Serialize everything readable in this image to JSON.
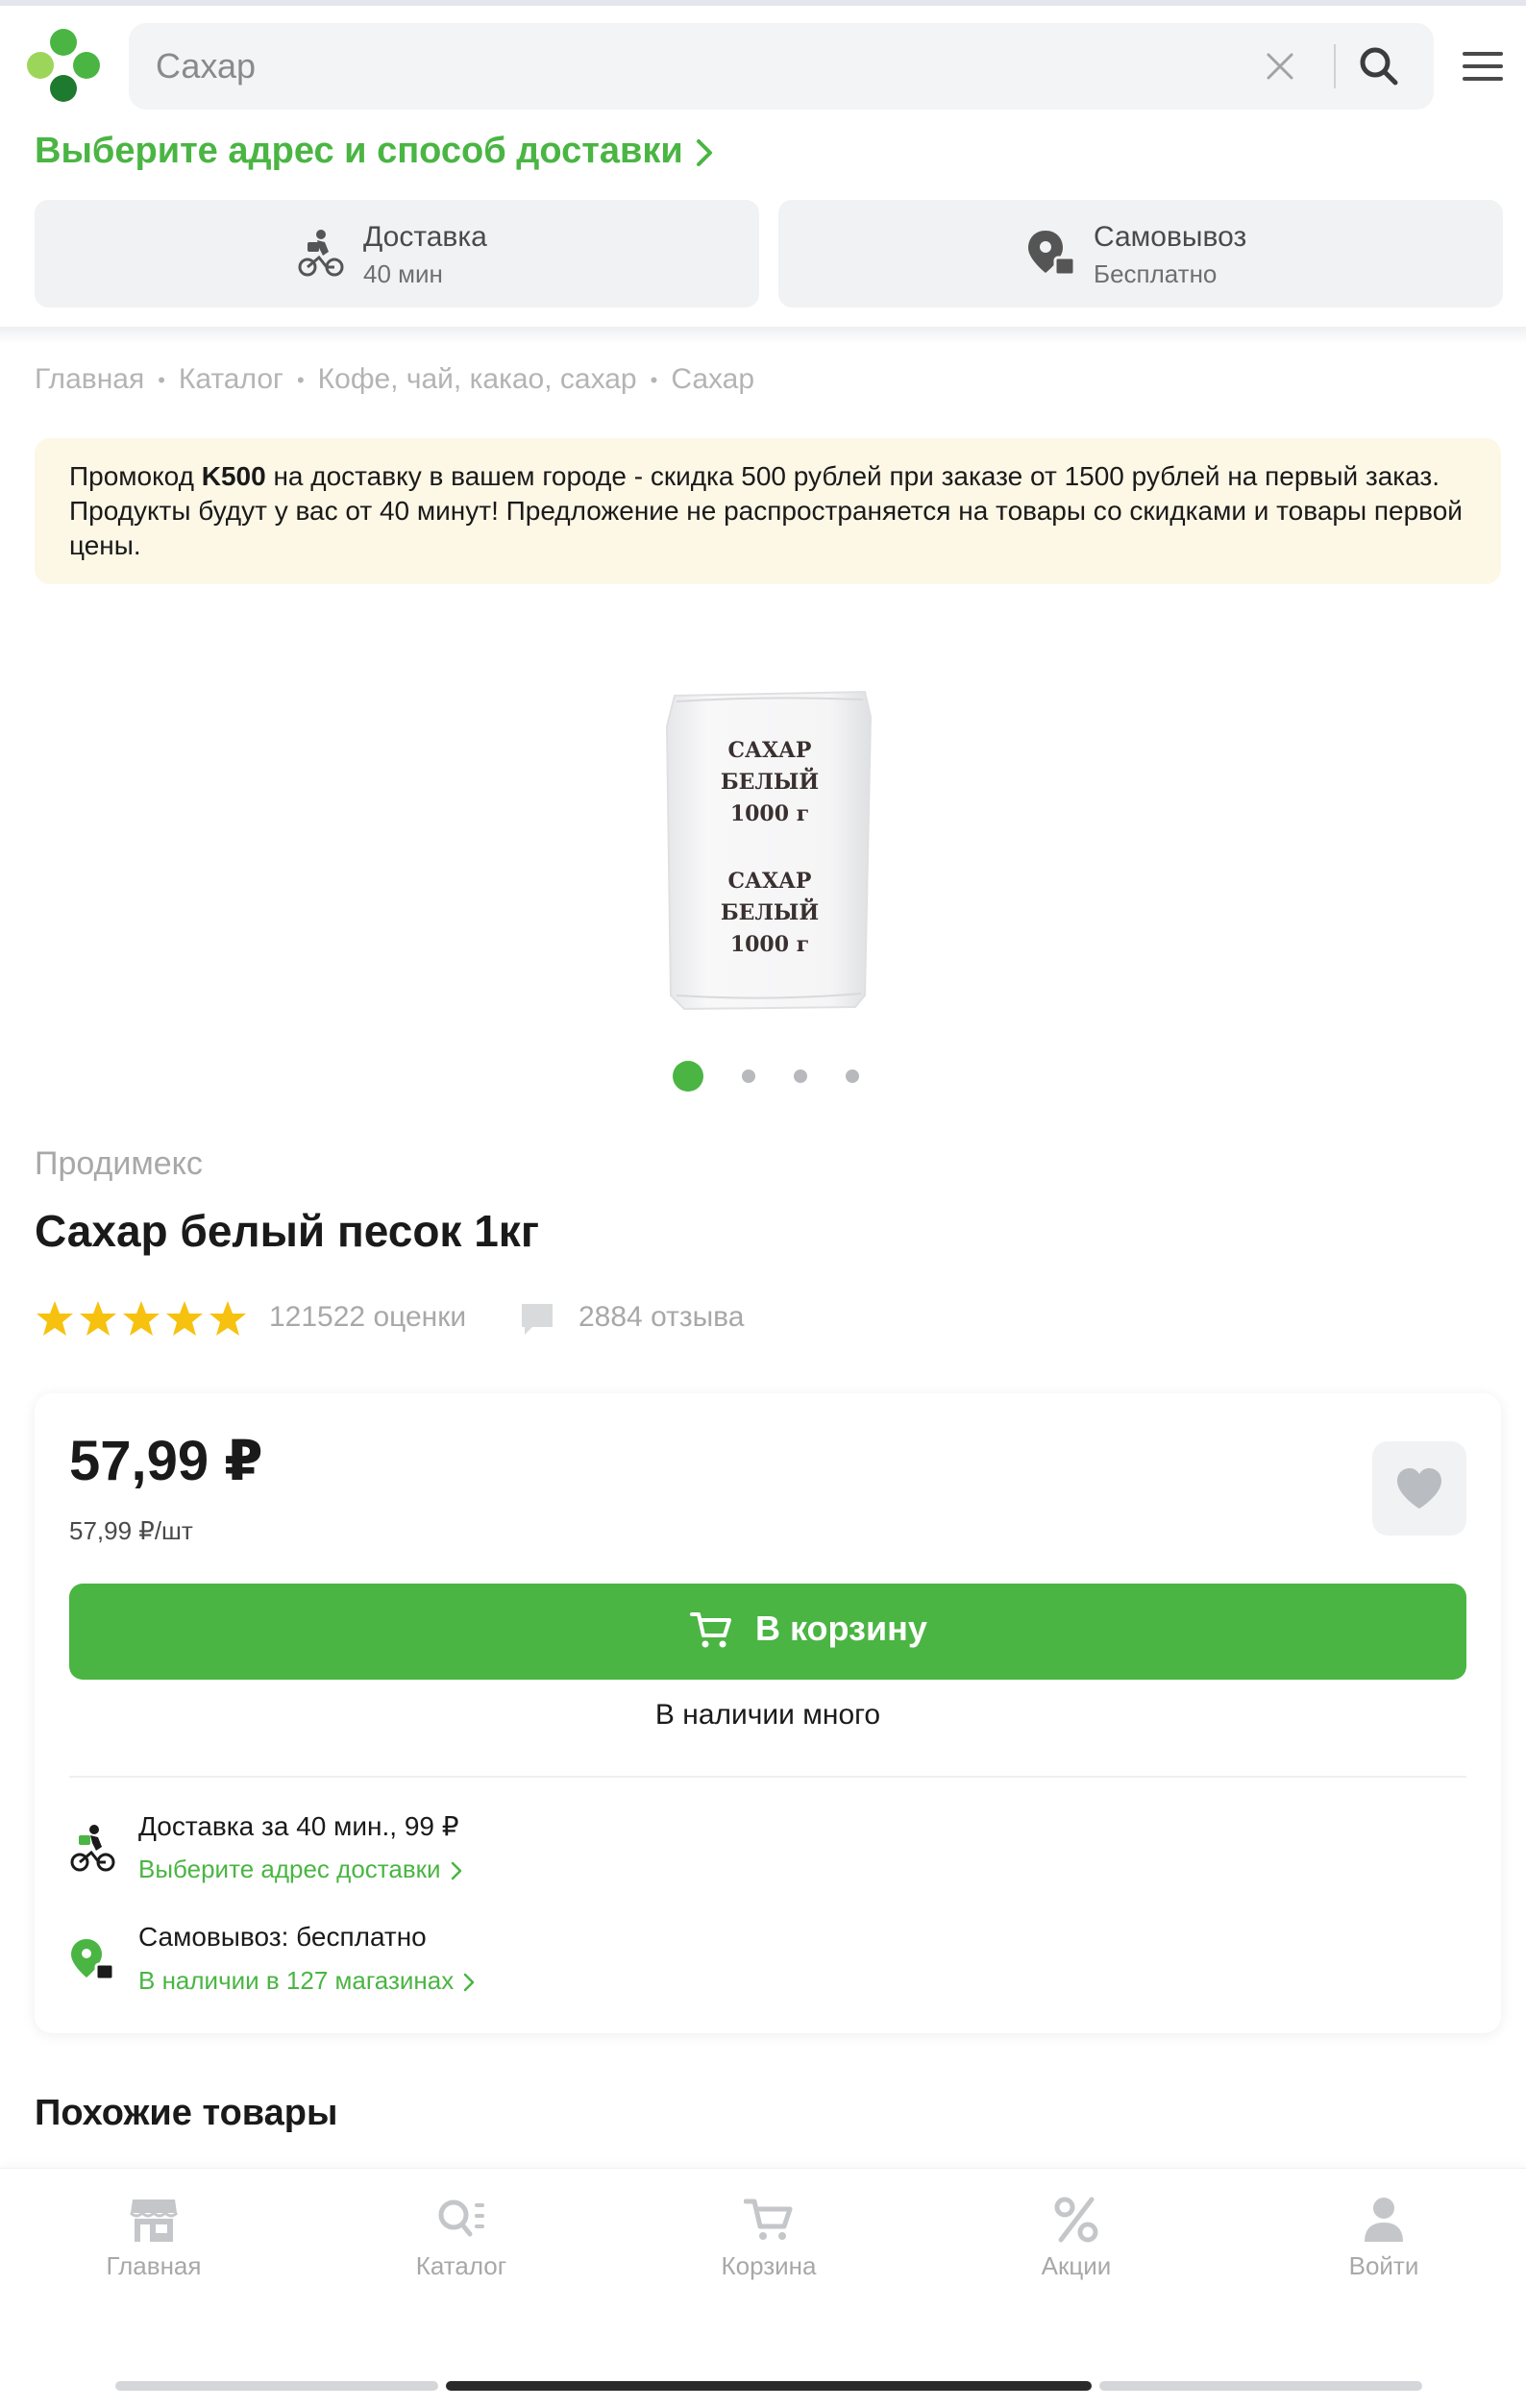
{
  "header": {
    "search_placeholder": "Сахар",
    "address_prompt": "Выберите адрес и способ доставки",
    "delivery": {
      "label": "Доставка",
      "time": "40 мин"
    },
    "pickup": {
      "label": "Самовывоз",
      "price": "Бесплатно"
    }
  },
  "breadcrumb": [
    "Главная",
    "Каталог",
    "Кофе, чай, какао, сахар",
    "Сахар"
  ],
  "promo": {
    "before": "Промокод ",
    "code": "K500",
    "after": " на доставку в вашем городе - скидка 500 рублей при заказе от 1500 рублей на первый заказ. Продукты будут у вас от 40 минут! Предложение не распространяется на товары со скидками и товары первой цены."
  },
  "product_image": {
    "line1": "САХАР",
    "line2": "БЕЛЫЙ",
    "line3": "1000 г",
    "line4": "САХАР",
    "line5": "БЕЛЫЙ",
    "line6": "1000 г"
  },
  "gallery": {
    "active": 1,
    "count": 4
  },
  "product": {
    "brand": "Продимекс",
    "title": "Сахар белый песок 1кг",
    "rating_stars": 5,
    "ratings_count": "121522 оценки",
    "reviews_count": "2884 отзыва",
    "price": "57,99 ₽",
    "unit_price": "57,99 ₽/шт",
    "cart_label": "В корзину",
    "stock": "В наличии много"
  },
  "shipping": {
    "delivery_line": "Доставка за 40 мин., 99 ₽",
    "delivery_link": "Выберите адрес доставки",
    "pickup_line": "Самовывоз: бесплатно",
    "pickup_link": "В наличии в 127 магазинах"
  },
  "similar_title": "Похожие товары",
  "nav": [
    {
      "label": "Главная",
      "icon": "store-icon"
    },
    {
      "label": "Каталог",
      "icon": "catalog-search-icon"
    },
    {
      "label": "Корзина",
      "icon": "cart-icon"
    },
    {
      "label": "Акции",
      "icon": "percent-icon"
    },
    {
      "label": "Войти",
      "icon": "user-icon"
    }
  ],
  "colors": {
    "brand_green": "#4ab543",
    "promo_bg": "#fdf7e6",
    "star": "#f6c20f",
    "muted": "#a8a8a8"
  }
}
